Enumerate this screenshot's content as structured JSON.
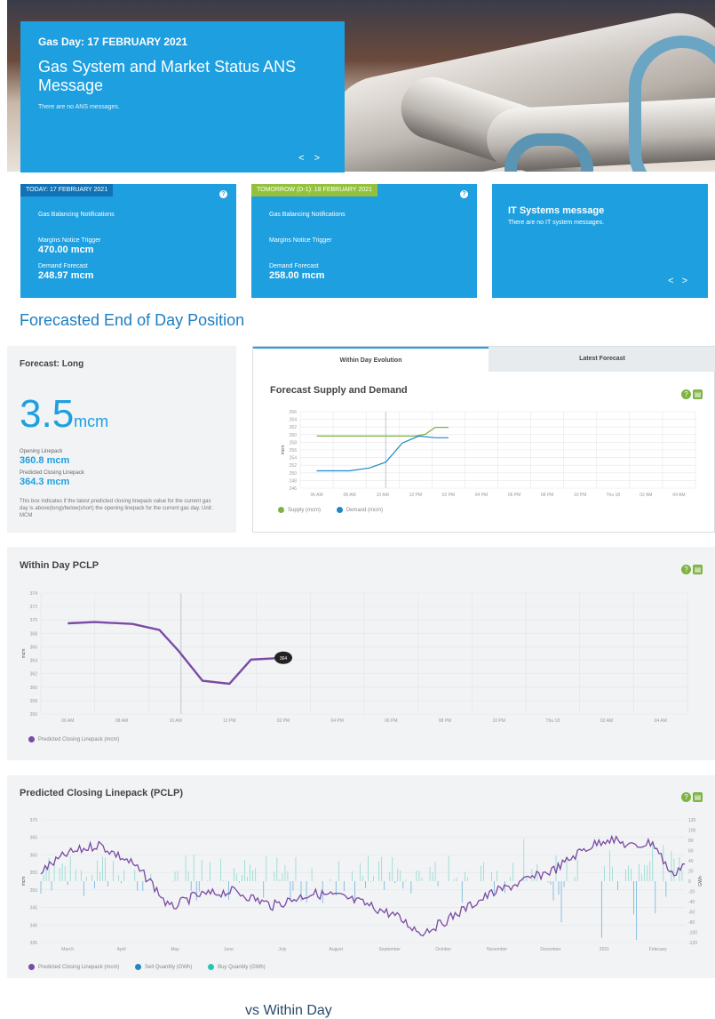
{
  "hero": {
    "gas_day": "Gas Day: 17 FEBRUARY 2021",
    "title": "Gas System and Market Status ANS Message",
    "message": "There are no ANS messages.",
    "arrows": "< >"
  },
  "today": {
    "tag": "TODAY: 17 FEBRUARY 2021",
    "gbn": "Gas Balancing Notifications",
    "margins_label": "Margins Notice Trigger",
    "margins_value": "470.00  mcm",
    "demand_label": "Demand Forecast",
    "demand_value": "248.97  mcm"
  },
  "tomorrow": {
    "tag": "TOMORROW (D-1): 18 FEBRUARY 2021",
    "gbn": "Gas Balancing Notifications",
    "margins_label": "Margins Notice Trigger",
    "demand_label": "Demand Forecast",
    "demand_value": "258.00  mcm"
  },
  "it": {
    "title": "IT Systems message",
    "message": "There are no IT system messages.",
    "arrows": "< >"
  },
  "section_title": "Forecasted End of Day Position",
  "forecast_long": {
    "title": "Forecast: Long",
    "value": "3.5",
    "unit": "mcm",
    "opening_label": "Opening Linepack",
    "opening_value": "360.8 mcm",
    "closing_label": "Predicted Closing Linepack",
    "closing_value": "364.3 mcm",
    "note": "This box indicates if the latest predicted closing linepack value for the current gas day is above(long)/below(short) the opening linepack for the current gas day. Unit: MCM"
  },
  "tabs": {
    "active": "Within Day Evolution",
    "inactive": "Latest Forecast"
  },
  "icons": {
    "help": "question-icon",
    "export": "export-icon"
  },
  "chart_data": [
    {
      "type": "line",
      "title": "Forecast Supply and Demand",
      "ylabel": "mcm",
      "x": [
        "06 AM",
        "08 AM",
        "10 AM",
        "12 PM",
        "02 PM",
        "04 PM",
        "06 PM",
        "08 PM",
        "10 PM",
        "Thu 18",
        "02 AM",
        "04 AM"
      ],
      "yticks": [
        "266",
        "264",
        "262",
        "260",
        "258",
        "256",
        "254",
        "252",
        "250",
        "248",
        "246"
      ],
      "ylim": [
        245,
        267
      ],
      "series": [
        {
          "name": "Supply (mcm)",
          "color": "#7cb342",
          "points": [
            [
              0,
              260
            ],
            [
              1,
              260
            ],
            [
              2,
              260
            ],
            [
              3,
              260
            ],
            [
              3.3,
              260.5
            ],
            [
              3.6,
              262.5
            ],
            [
              4,
              262.5
            ]
          ]
        },
        {
          "name": "Demand (mcm)",
          "color": "#1e88c7",
          "points": [
            [
              0,
              250
            ],
            [
              1,
              250
            ],
            [
              1.6,
              250.8
            ],
            [
              2.1,
              252.5
            ],
            [
              2.6,
              258
            ],
            [
              3.1,
              260
            ],
            [
              3.6,
              259.5
            ],
            [
              4,
              259.5
            ]
          ]
        }
      ]
    },
    {
      "type": "line",
      "title": "Within Day PCLP",
      "ylabel": "mcm",
      "x": [
        "06 AM",
        "08 AM",
        "10 AM",
        "12 PM",
        "02 PM",
        "04 PM",
        "06 PM",
        "08 PM",
        "10 PM",
        "Thu 18",
        "02 AM",
        "04 AM"
      ],
      "yticks": [
        "374",
        "372",
        "370",
        "368",
        "366",
        "364",
        "362",
        "360",
        "358",
        "356"
      ],
      "ylim": [
        355,
        375
      ],
      "marker_label": "364",
      "series": [
        {
          "name": "Predicted Closing Linepack (mcm)",
          "color": "#7b4aa4",
          "points": [
            [
              0,
              370
            ],
            [
              0.5,
              370.2
            ],
            [
              1.2,
              369.9
            ],
            [
              1.7,
              368.9
            ],
            [
              2.05,
              365.5
            ],
            [
              2.5,
              360.5
            ],
            [
              3.0,
              360
            ],
            [
              3.4,
              364
            ],
            [
              4,
              364.3
            ]
          ]
        }
      ]
    },
    {
      "type": "line",
      "title": "Predicted Closing Linepack (PCLP)",
      "ylabel_left": "mcm",
      "ylabel_right": "GWh",
      "x": [
        "March",
        "April",
        "May",
        "June",
        "July",
        "August",
        "September",
        "October",
        "November",
        "December",
        "2021",
        "February"
      ],
      "yticks_left": [
        "370",
        "365",
        "360",
        "355",
        "350",
        "345",
        "340",
        "335"
      ],
      "yticks_right": [
        "120",
        "100",
        "80",
        "60",
        "40",
        "20",
        "0",
        "-20",
        "-40",
        "-60",
        "-80",
        "-100",
        "-120"
      ],
      "series": [
        {
          "name": "Predicted Closing Linepack (mcm)",
          "color": "#7b4aa4"
        },
        {
          "name": "Sell Quantity (GWh)",
          "color": "#1e88c7"
        },
        {
          "name": "Buy Quantity (GWh)",
          "color": "#26c6b4"
        }
      ]
    }
  ],
  "bottom_title": "vs Within Day"
}
